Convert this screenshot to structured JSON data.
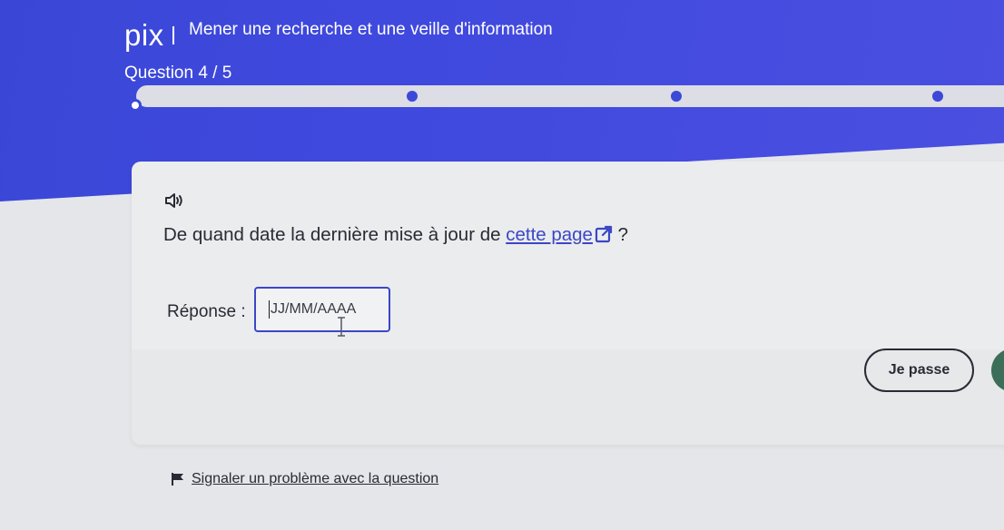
{
  "header": {
    "logo": "pix",
    "title": "Mener une recherche et une veille d'information"
  },
  "progress": {
    "label": "Question 4 / 5",
    "current": 4,
    "total": 5
  },
  "question": {
    "text_before_link": "De quand date la dernière mise à jour de ",
    "link_text": "cette page",
    "text_after_link": " ?"
  },
  "answer": {
    "label": "Réponse :",
    "placeholder": "JJ/MM/AAAA",
    "value": ""
  },
  "actions": {
    "skip_label": "Je passe"
  },
  "report": {
    "label": "Signaler un problème avec la question"
  },
  "colors": {
    "brand_blue": "#3a47d6",
    "link_blue": "#3b47c7",
    "validate_green": "#3c6e5a",
    "text": "#2a2a35"
  },
  "icons": [
    "audio-icon",
    "external-link-icon",
    "text-cursor-icon",
    "flag-icon"
  ]
}
